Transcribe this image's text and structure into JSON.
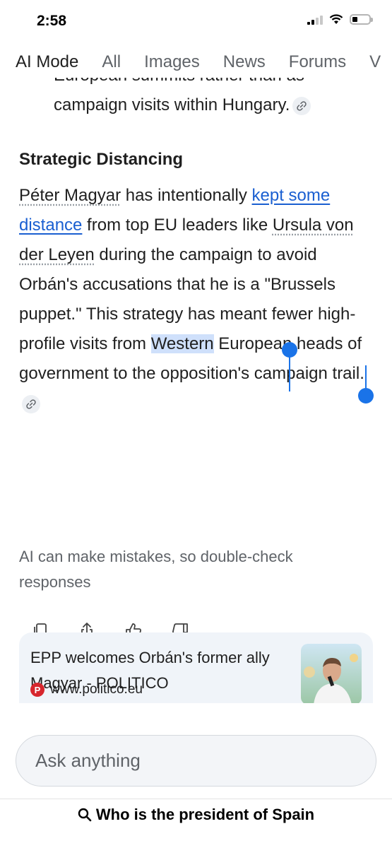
{
  "status_bar": {
    "time": "2:58"
  },
  "tabs": [
    "AI Mode",
    "All",
    "Images",
    "News",
    "Forums",
    "V"
  ],
  "article": {
    "prev_bullet_clipped": "European summits rather than as",
    "prev_bullet_line": "campaign visits within Hungary.",
    "section_title": "Strategic Distancing",
    "para": {
      "entity1": "Péter Magyar",
      "t1": " has intentionally ",
      "link": "kept some distance",
      "t2": " from top EU leaders like ",
      "entity2": "Ursula von der Leyen",
      "t3": " during the campaign to avoid Orbán's accusations that he is a \"Brussels puppet.\" This strategy has meant fewer high-profile visits from ",
      "selected": "Western",
      "t4": " European heads of government to the opposition's campaign trail."
    },
    "disclaimer": "AI can make mistakes, so double-check responses"
  },
  "actions": {
    "icons": [
      "copy-icon",
      "share-icon",
      "thumbs-up-icon",
      "thumbs-down-icon"
    ]
  },
  "source_card": {
    "title": "EPP welcomes Orbán's former ally Magyar - POLITICO",
    "favicon_letter": "P",
    "domain": "www.politico.eu"
  },
  "ask": {
    "placeholder": "Ask anything"
  },
  "query_pill": {
    "text": "Who is the president of Spain"
  },
  "colors": {
    "link": "#1a5fd1",
    "selection": "#cfe0fb",
    "handle": "#1a73e8"
  }
}
